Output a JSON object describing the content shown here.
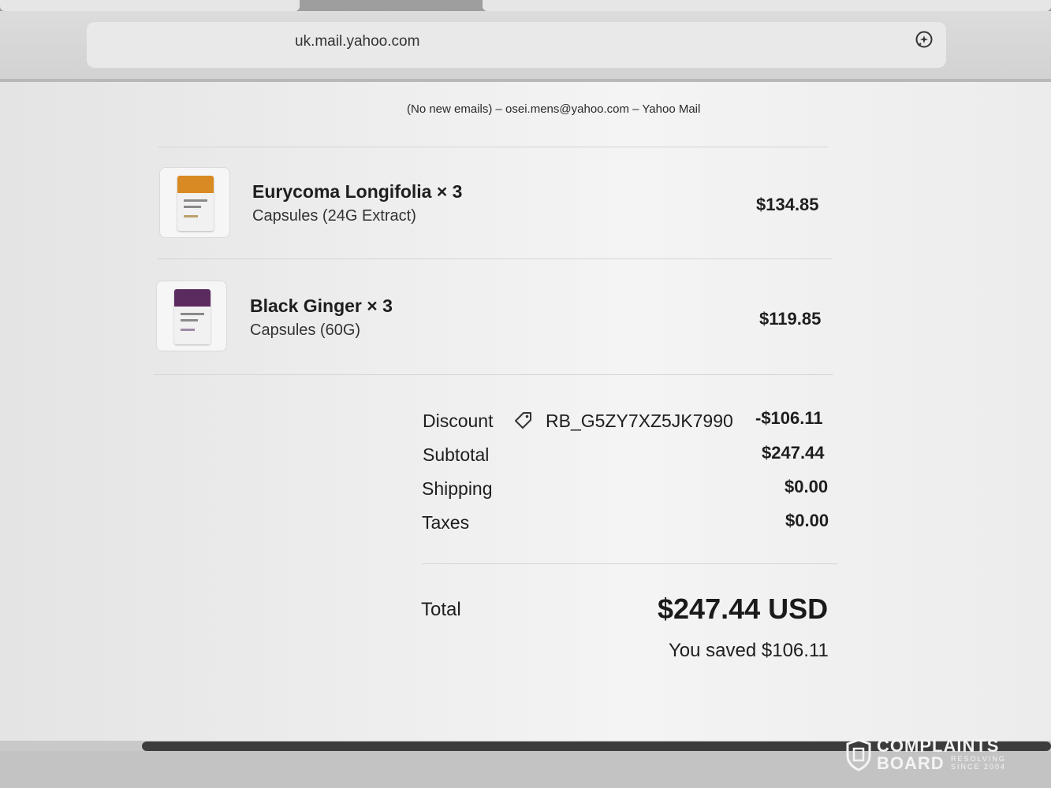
{
  "browser": {
    "url": "uk.mail.yahoo.com",
    "ai_icon": "sparkle-chat-icon"
  },
  "mail": {
    "window_title": "(No new emails) – osei.mens@yahoo.com – Yahoo Mail"
  },
  "order": {
    "items": [
      {
        "name": "Eurycoma Longifolia × 3",
        "variant": "Capsules (24G Extract)",
        "price": "$134.85",
        "thumb_color": "#d98a22"
      },
      {
        "name": "Black Ginger × 3",
        "variant": "Capsules (60G)",
        "price": "$119.85",
        "thumb_color": "#5b2a5e"
      }
    ],
    "summary": {
      "discount_label": "Discount",
      "discount_icon": "tag-icon",
      "discount_code": "RB_G5ZY7XZ5JK7990",
      "discount_value": "-$106.11",
      "subtotal_label": "Subtotal",
      "subtotal_value": "$247.44",
      "shipping_label": "Shipping",
      "shipping_value": "$0.00",
      "taxes_label": "Taxes",
      "taxes_value": "$0.00"
    },
    "total": {
      "label": "Total",
      "value": "$247.44 USD",
      "saved": "You saved $106.11"
    }
  },
  "watermark": {
    "line1": "COMPLAINTS",
    "line2": "BOARD",
    "tag1": "RESOLVING",
    "tag2": "SINCE 2004"
  }
}
